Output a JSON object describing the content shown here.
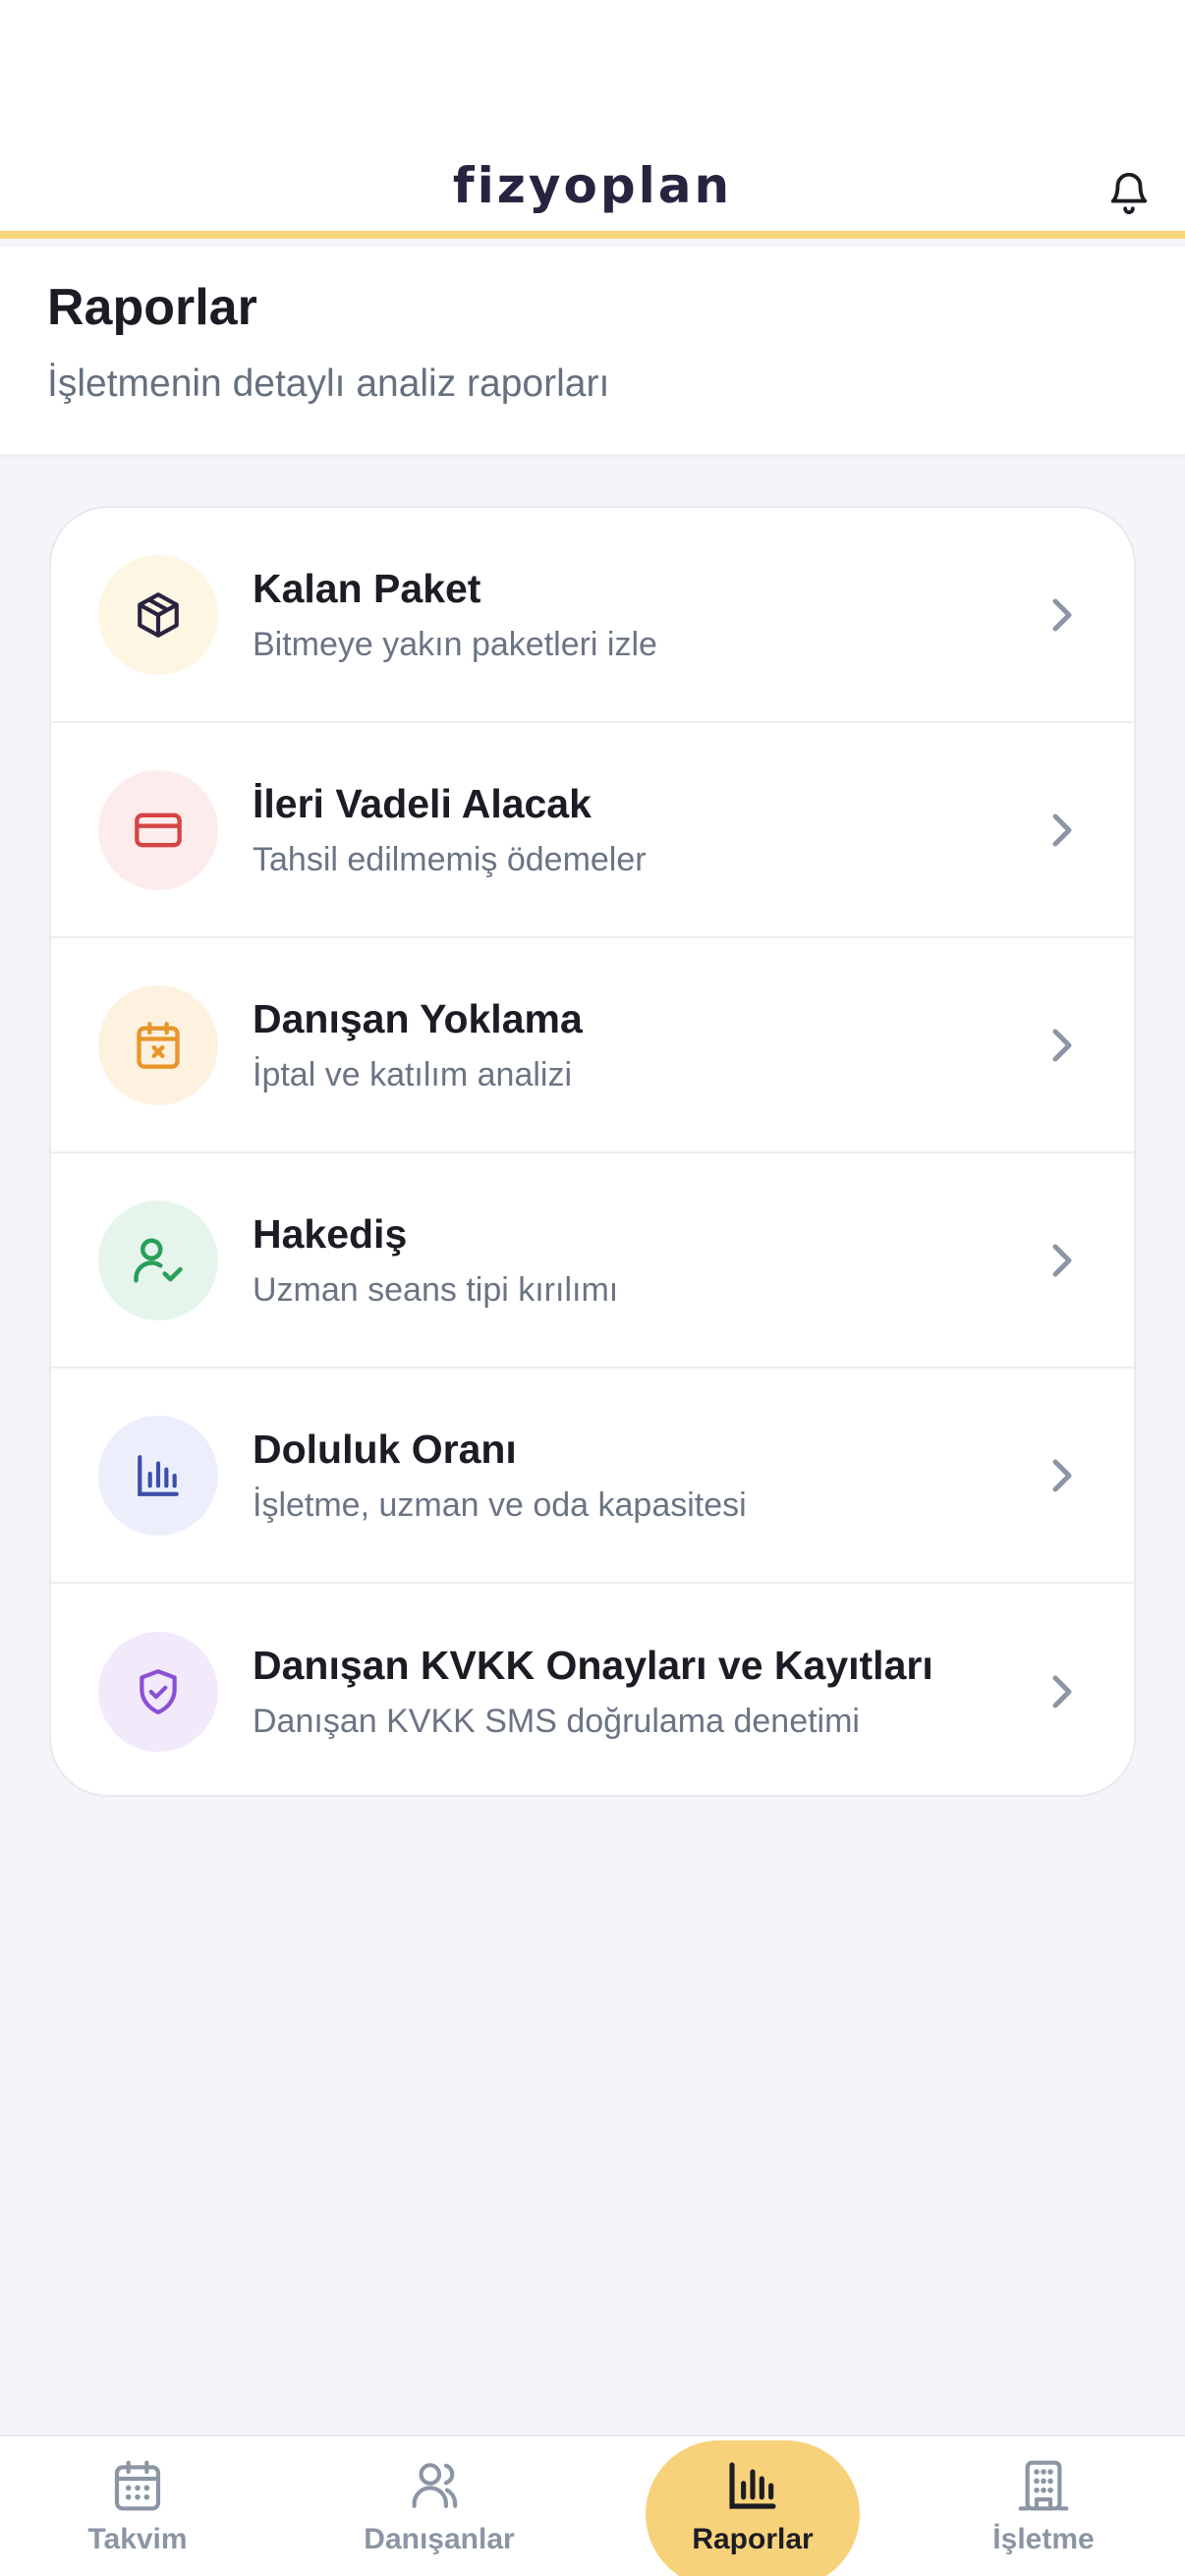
{
  "header": {
    "brand": "fizyoplan",
    "bell_icon": "bell-icon"
  },
  "page": {
    "title": "Raporlar",
    "subtitle": "İşletmenin detaylı analiz raporları"
  },
  "reports": [
    {
      "title": "Kalan Paket",
      "subtitle": "Bitmeye yakın paketleri izle",
      "icon": "package-icon",
      "color": "#2a2340",
      "bg": "#fdf6e3"
    },
    {
      "title": "İleri Vadeli Alacak",
      "subtitle": "Tahsil edilmemiş ödemeler",
      "icon": "credit-card-icon",
      "color": "#d64545",
      "bg": "#fdecec"
    },
    {
      "title": "Danışan Yoklama",
      "subtitle": "İptal ve katılım analizi",
      "icon": "calendar-x-icon",
      "color": "#e8962a",
      "bg": "#fdf1e0"
    },
    {
      "title": "Hakediş",
      "subtitle": "Uzman seans tipi kırılımı",
      "icon": "user-check-icon",
      "color": "#27a05a",
      "bg": "#e6f5ec"
    },
    {
      "title": "Doluluk Oranı",
      "subtitle": "İşletme, uzman ve oda kapasitesi",
      "icon": "bar-chart-icon",
      "color": "#3c4fa8",
      "bg": "#eceffb"
    },
    {
      "title": "Danışan KVKK Onayları ve Kayıtları",
      "subtitle": "Danışan KVKK SMS doğrulama denetimi",
      "icon": "shield-check-icon",
      "color": "#8a4fd6",
      "bg": "#f2e9fb"
    }
  ],
  "nav": [
    {
      "label": "Takvim",
      "icon": "calendar-icon"
    },
    {
      "label": "Danışanlar",
      "icon": "users-icon"
    },
    {
      "label": "Raporlar",
      "icon": "bar-chart-icon",
      "active": true
    },
    {
      "label": "İşletme",
      "icon": "building-icon"
    }
  ],
  "colors": {
    "accent": "#f7d27a",
    "header_border": "#f6d57a",
    "background": "#f3f5f9"
  }
}
